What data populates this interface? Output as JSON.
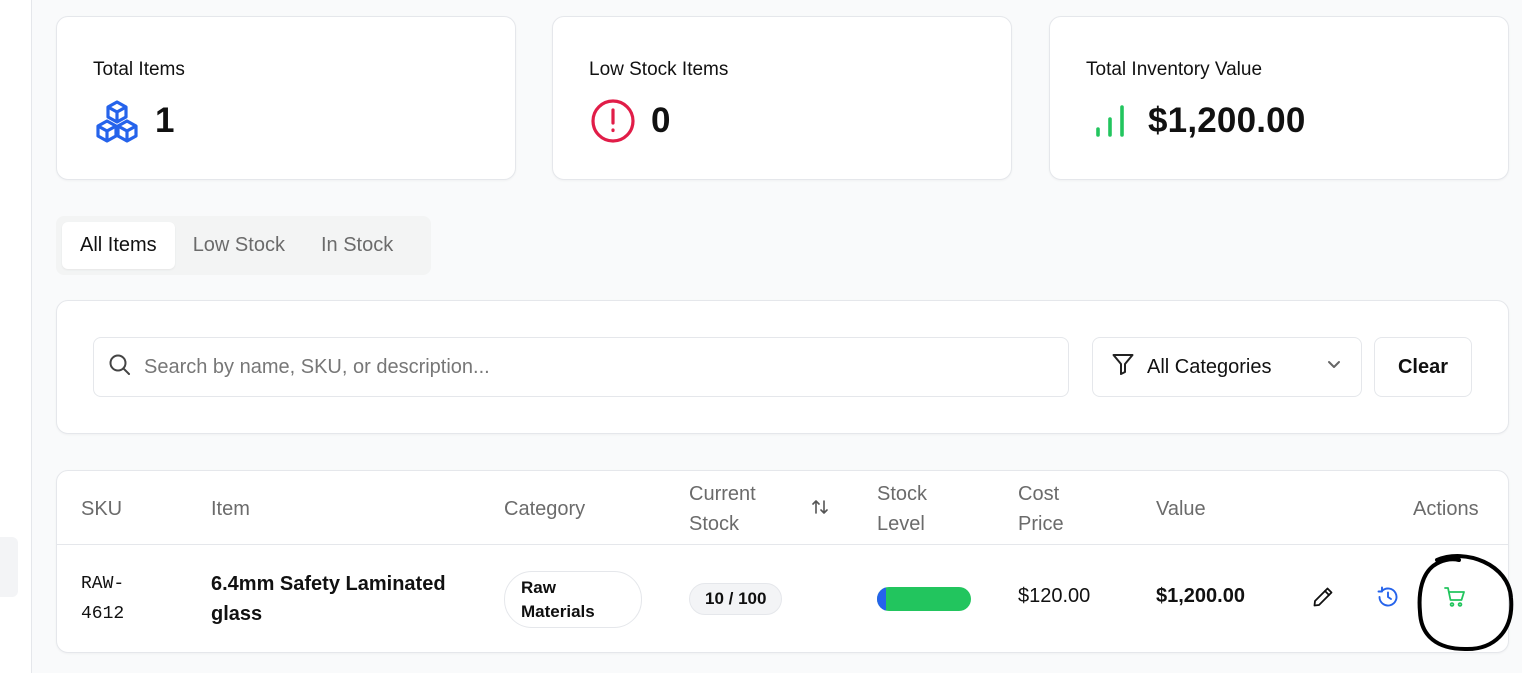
{
  "stats": [
    {
      "title": "Total Items",
      "value": "1",
      "icon": "cubes-icon",
      "color": "#2563eb"
    },
    {
      "title": "Low Stock Items",
      "value": "0",
      "icon": "alert-circle-icon",
      "color": "#e11d48"
    },
    {
      "title": "Total Inventory Value",
      "value": "$1,200.00",
      "icon": "signal-bars-icon",
      "color": "#22c55e"
    }
  ],
  "tabs": [
    {
      "label": "All Items",
      "active": true
    },
    {
      "label": "Low Stock",
      "active": false
    },
    {
      "label": "In Stock",
      "active": false
    }
  ],
  "filters": {
    "search_placeholder": "Search by name, SKU, or description...",
    "search_value": "",
    "category_selected": "All Categories",
    "clear_label": "Clear"
  },
  "table": {
    "headers": {
      "sku": "SKU",
      "item": "Item",
      "category": "Category",
      "current_stock_1": "Current",
      "current_stock_2": "Stock",
      "stock_level_1": "Stock",
      "stock_level_2": "Level",
      "cost_price_1": "Cost",
      "cost_price_2": "Price",
      "value": "Value",
      "actions": "Actions"
    },
    "rows": [
      {
        "sku_1": "RAW-",
        "sku_2": "4612",
        "item_1": "6.4mm Safety Laminated",
        "item_2": "glass",
        "category_1": "Raw",
        "category_2": "Materials",
        "current_stock": "10 / 100",
        "stock_level_fraction": 0.1,
        "cost_price": "$120.00",
        "value": "$1,200.00"
      }
    ]
  },
  "colors": {
    "accent_blue": "#2563eb",
    "success_green": "#22c55e",
    "danger_red": "#e11d48"
  }
}
